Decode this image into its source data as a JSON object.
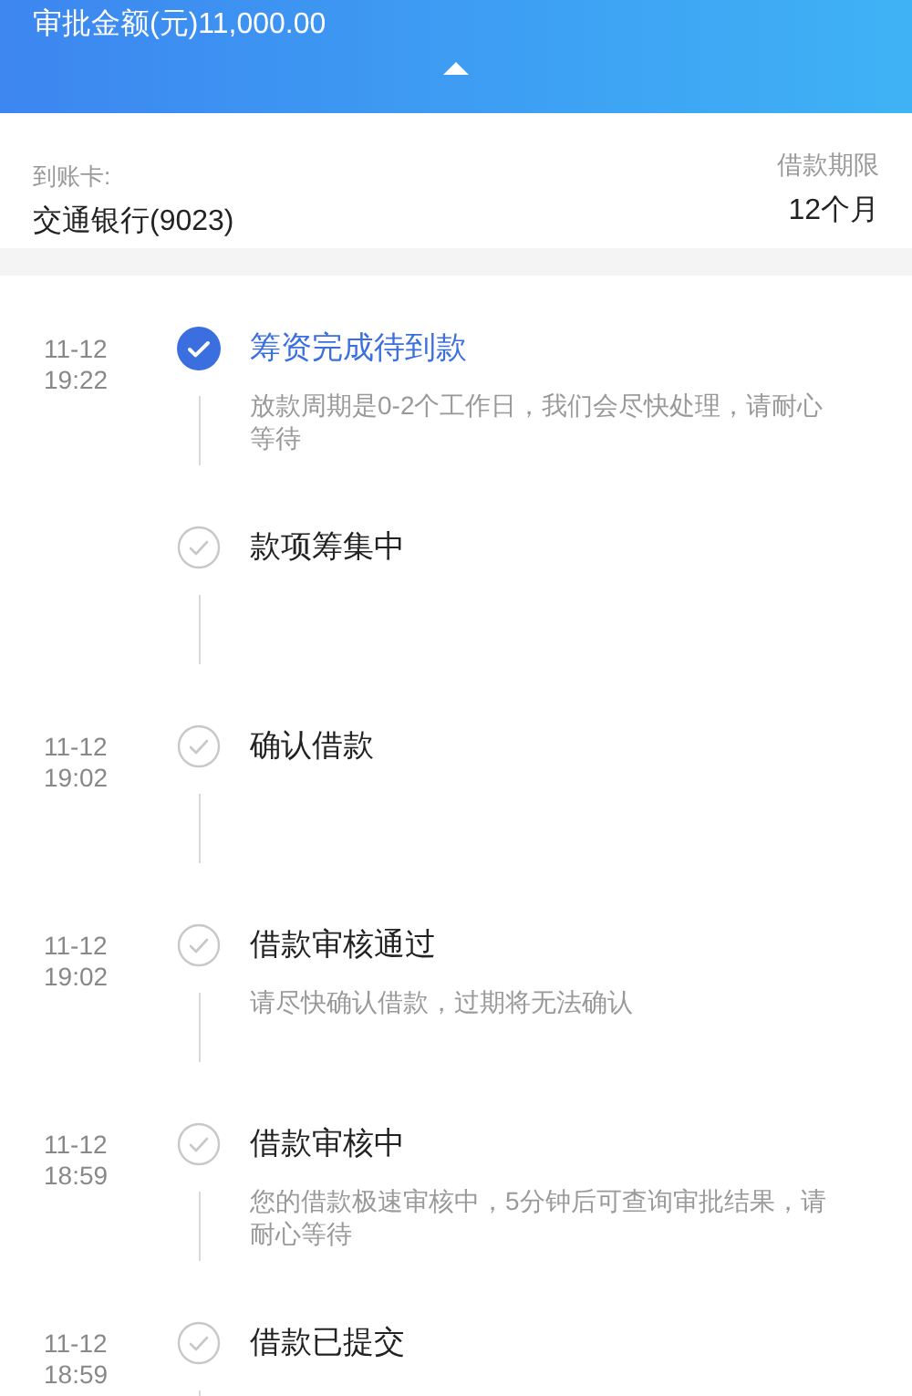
{
  "header": {
    "approved_amount": "审批金额(元)11,000.00"
  },
  "account": {
    "card_label": "到账卡:",
    "card_value": "交通银行(9023)",
    "term_label": "借款期限",
    "term_value": "12个月"
  },
  "timeline": [
    {
      "date": "11-12",
      "time": "19:22",
      "title": "筹资完成待到款",
      "description": "放款周期是0-2个工作日，我们会尽快处理，请耐心等待",
      "active": true
    },
    {
      "title": "款项筹集中",
      "active": false
    },
    {
      "date": "11-12",
      "time": "19:02",
      "title": "确认借款",
      "active": false
    },
    {
      "date": "11-12",
      "time": "19:02",
      "title": "借款审核通过",
      "description": "请尽快确认借款，过期将无法确认",
      "active": false
    },
    {
      "date": "11-12",
      "time": "18:59",
      "title": "借款审核中",
      "description": "您的借款极速审核中，5分钟后可查询审批结果，请耐心等待",
      "active": false
    },
    {
      "date": "11-12",
      "time": "18:59",
      "title": "借款已提交",
      "active": false
    }
  ]
}
